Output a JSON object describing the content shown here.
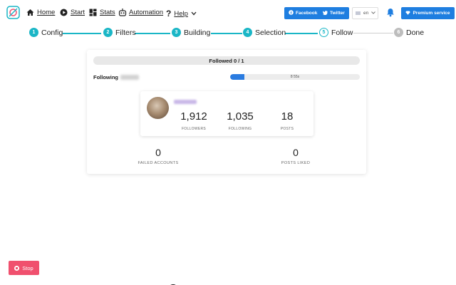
{
  "nav": {
    "items": [
      {
        "label": "Home",
        "icon": "home-icon"
      },
      {
        "label": "Start",
        "icon": "play-icon"
      },
      {
        "label": "Stats",
        "icon": "grid-icon"
      },
      {
        "label": "Automation",
        "icon": "robot-icon"
      },
      {
        "label": "Help",
        "icon": "question-icon"
      }
    ],
    "facebook_label": "Facebook",
    "twitter_label": "Twitter",
    "language": "en",
    "premium_label": "Premium service",
    "colors": {
      "primary": "#1e7ee0",
      "accent": "#1ab6c6",
      "danger": "#f0506e"
    }
  },
  "steps": [
    {
      "num": "1",
      "label": "Config",
      "state": "done"
    },
    {
      "num": "2",
      "label": "Filters",
      "state": "done"
    },
    {
      "num": "3",
      "label": "Building",
      "state": "done"
    },
    {
      "num": "4",
      "label": "Selection",
      "state": "done"
    },
    {
      "num": "5",
      "label": "Follow",
      "state": "current"
    },
    {
      "num": "6",
      "label": "Done",
      "state": "todo"
    }
  ],
  "progress": {
    "label": "Followed 0 / 1",
    "following_label": "Following",
    "timer_text": "8 55s",
    "timer_fraction": 0.11
  },
  "profile": {
    "followers_value": "1,912",
    "followers_label": "FOLLOWERS",
    "following_value": "1,035",
    "following_label": "FOLLOWING",
    "posts_value": "18",
    "posts_label": "POSTS"
  },
  "summary": {
    "failed_value": "0",
    "failed_label": "FAILED ACCOUNTS",
    "liked_value": "0",
    "liked_label": "POSTS LIKED"
  },
  "stop_label": "Stop",
  "bottom_text": "emmawatson"
}
